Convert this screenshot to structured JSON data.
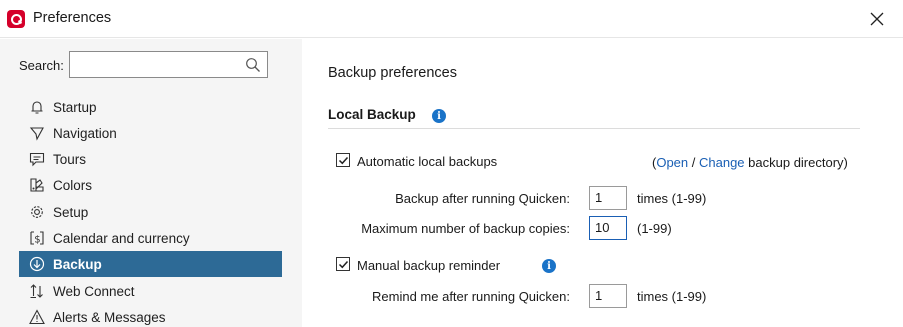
{
  "window": {
    "title": "Preferences"
  },
  "sidebar": {
    "search_label": "Search:",
    "search_value": "",
    "items": [
      {
        "label": "Startup",
        "icon": "bell-icon"
      },
      {
        "label": "Navigation",
        "icon": "navigation-icon"
      },
      {
        "label": "Tours",
        "icon": "tours-icon"
      },
      {
        "label": "Colors",
        "icon": "colors-icon"
      },
      {
        "label": "Setup",
        "icon": "gear-icon"
      },
      {
        "label": "Calendar and currency",
        "icon": "calendar-currency-icon"
      },
      {
        "label": "Backup",
        "icon": "backup-icon",
        "selected": true
      },
      {
        "label": "Web Connect",
        "icon": "web-connect-icon"
      },
      {
        "label": "Alerts & Messages",
        "icon": "alert-icon"
      }
    ]
  },
  "main": {
    "page_title": "Backup preferences",
    "section_title": "Local Backup",
    "auto_backup": {
      "checked": true,
      "label": "Automatic local backups",
      "dir_open_paren": "(",
      "dir_open_link": "Open",
      "dir_slash": " / ",
      "dir_change_link": "Change",
      "dir_suffix": " backup directory)"
    },
    "backup_after": {
      "label": "Backup after running Quicken:",
      "value": "1",
      "suffix": "times (1-99)"
    },
    "max_copies": {
      "label": "Maximum number of backup copies:",
      "value": "10",
      "suffix": "(1-99)"
    },
    "manual_reminder": {
      "checked": true,
      "label": "Manual backup reminder"
    },
    "remind_after": {
      "label": "Remind me after running Quicken:",
      "value": "1",
      "suffix": "times (1-99)"
    }
  },
  "colors": {
    "accent": "#2d6a96",
    "link": "#1a5fb4",
    "info": "#1a73c8",
    "brand": "#d5002a"
  }
}
